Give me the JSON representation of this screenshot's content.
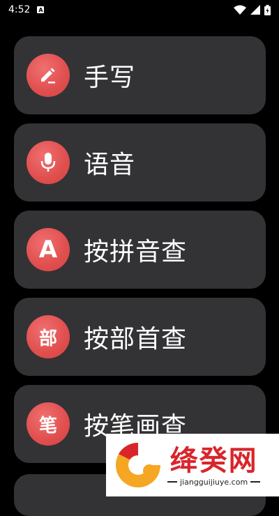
{
  "status_bar": {
    "time": "4:52",
    "notification_badge": "A"
  },
  "menu": {
    "items": [
      {
        "id": "handwriting",
        "label": "手写",
        "icon": "pencil-icon"
      },
      {
        "id": "voice",
        "label": "语音",
        "icon": "microphone-icon"
      },
      {
        "id": "pinyin",
        "label": "按拼音查",
        "icon_text": "A"
      },
      {
        "id": "radical",
        "label": "按部首查",
        "icon_text": "部"
      },
      {
        "id": "stroke",
        "label": "按笔画查",
        "icon_text": "笔"
      }
    ]
  },
  "watermark": {
    "title": "绛癸网",
    "subtitle": "jiangguijiuye.com"
  },
  "colors": {
    "accent": "#e04e4e",
    "card": "#333336",
    "background": "#000000",
    "watermark_red": "#d9252a"
  }
}
